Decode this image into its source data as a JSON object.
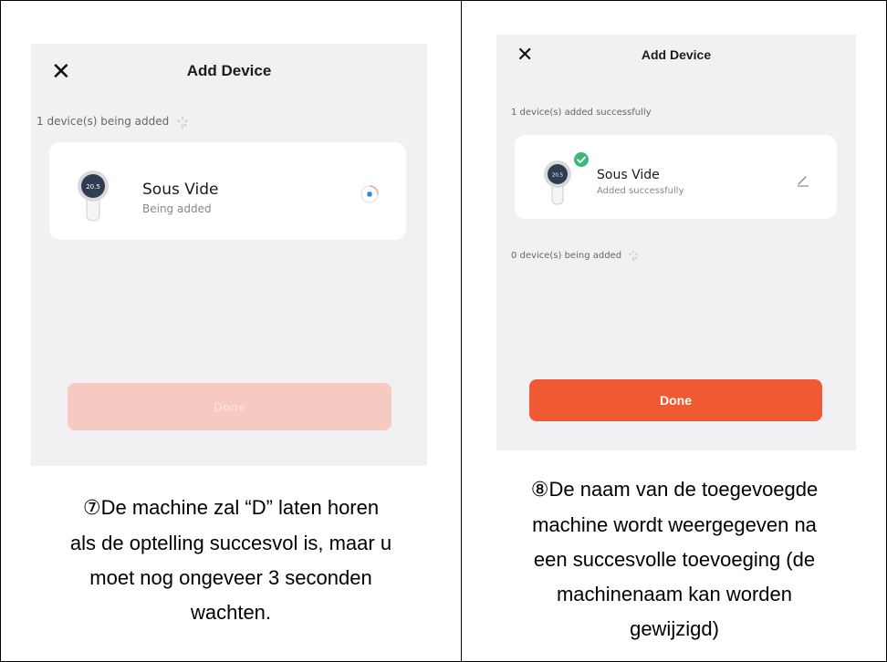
{
  "left_screen": {
    "close_glyph": "✕",
    "title": "Add Device",
    "status": "1 device(s) being added",
    "device": {
      "name": "Sous Vide",
      "status": "Being added",
      "display": "20.5"
    },
    "button_label": "Done"
  },
  "right_screen": {
    "close_glyph": "✕",
    "title": "Add Device",
    "status_success": "1 device(s) added successfully",
    "device": {
      "name": "Sous Vide",
      "status": "Added successfully",
      "display": "20.5"
    },
    "status_pending": "0 device(s) being added",
    "button_label": "Done"
  },
  "captions": {
    "step7_number": "⑦",
    "step7_lines": [
      "De machine zal “D” laten horen",
      "als de optelling succesvol is, maar u",
      "moet nog ongeveer 3 seconden",
      "wachten."
    ],
    "step8_number": "⑧",
    "step8_lines": [
      "De naam van de toegevoegde",
      "machine wordt weergegeven na",
      "een succesvolle toevoeging (de",
      "machinenaam kan worden",
      "gewijzigd)"
    ]
  },
  "colors": {
    "accent": "#ef5a33",
    "accent_disabled": "#f6c9c1",
    "success": "#3cb878",
    "panel_bg": "#f1f1f3"
  }
}
